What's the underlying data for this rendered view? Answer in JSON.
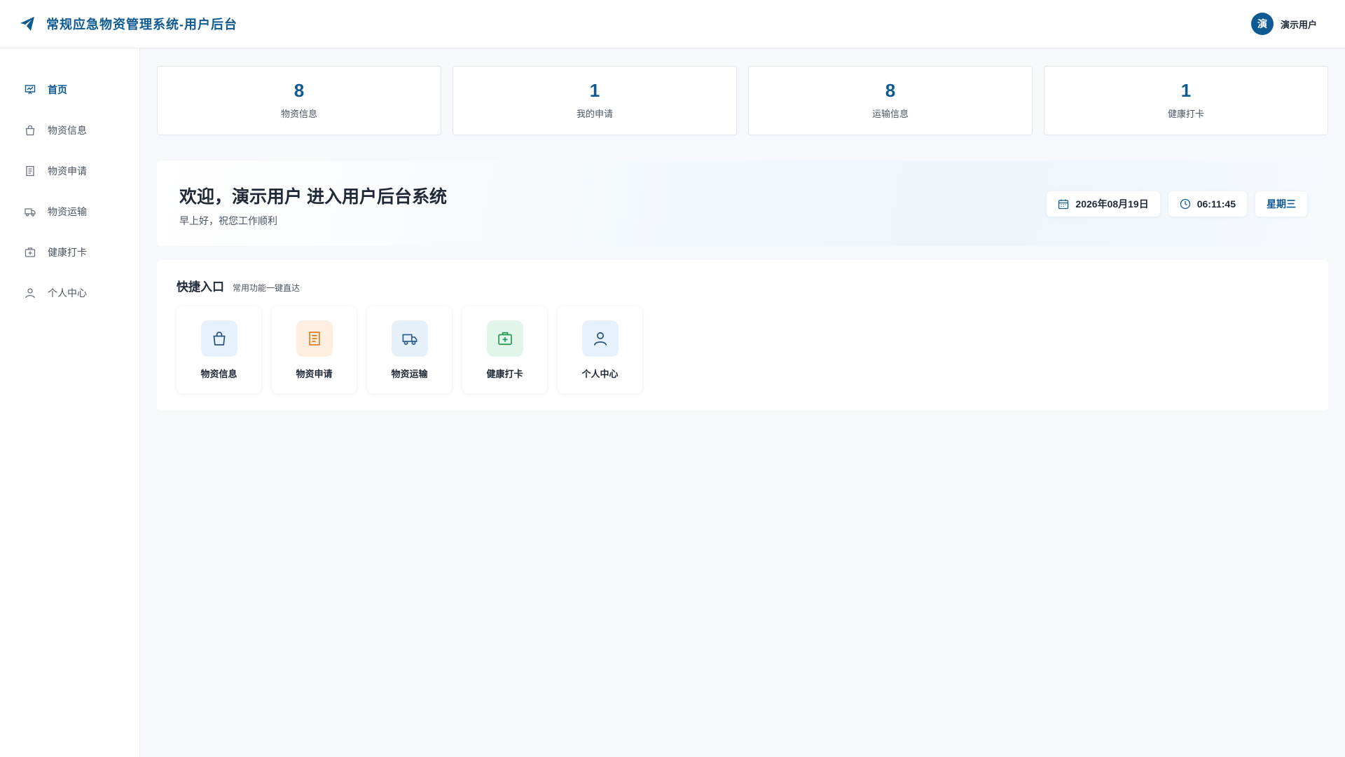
{
  "header": {
    "title": "常规应急物资管理系统-用户后台",
    "user": {
      "avatar_text": "演",
      "name": "演示用户"
    }
  },
  "sidebar": {
    "items": [
      {
        "label": "首页",
        "icon": "dashboard-icon",
        "active": true
      },
      {
        "label": "物资信息",
        "icon": "shopping-bag-icon"
      },
      {
        "label": "物资申请",
        "icon": "document-icon"
      },
      {
        "label": "物资运输",
        "icon": "truck-icon"
      },
      {
        "label": "健康打卡",
        "icon": "medical-kit-icon"
      },
      {
        "label": "个人中心",
        "icon": "user-icon"
      }
    ]
  },
  "stats": [
    {
      "value": "8",
      "label": "物资信息"
    },
    {
      "value": "1",
      "label": "我的申请"
    },
    {
      "value": "8",
      "label": "运输信息"
    },
    {
      "value": "1",
      "label": "健康打卡"
    }
  ],
  "welcome": {
    "title": "欢迎，演示用户 进入用户后台系统",
    "subtitle": "早上好，祝您工作顺利",
    "date": "2026年08月19日",
    "time": "06:11:45",
    "weekday": "星期三"
  },
  "quick": {
    "title": "快捷入口",
    "subtitle": "常用功能一键直达",
    "items": [
      {
        "label": "物资信息",
        "icon": "shopping-bag-icon",
        "color": "#1f4e79",
        "bg": "#e6f1fb"
      },
      {
        "label": "物资申请",
        "icon": "document-icon",
        "color": "#e07b1a",
        "bg": "#fdeee0"
      },
      {
        "label": "物资运输",
        "icon": "truck-icon",
        "color": "#2d5d8a",
        "bg": "#e6f0f8"
      },
      {
        "label": "健康打卡",
        "icon": "medical-kit-icon",
        "color": "#1f9a55",
        "bg": "#e2f5ea"
      },
      {
        "label": "个人中心",
        "icon": "user-icon",
        "color": "#1f4e79",
        "bg": "#e6f1fb"
      }
    ]
  },
  "colors": {
    "primary": "#0f5a93",
    "background": "#f6f8fb"
  }
}
